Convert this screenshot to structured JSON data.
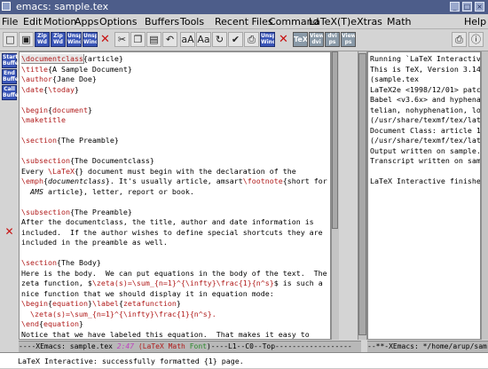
{
  "window": {
    "title": "emacs: sample.tex"
  },
  "menu": [
    "File",
    "Edit",
    "Motion",
    "Apps",
    "Options",
    "Buffers",
    "Tools",
    "Recent Files",
    "Command",
    "LaTeX",
    "(T)eXtras",
    "Math",
    "Help"
  ],
  "toolbar": {
    "zip1": "Zip\nWd",
    "zip2": "Zip\nWd",
    "unsplit1": "Unsplit\nWindow",
    "unsplit2": "Unsplit\nWindow",
    "tex_label": "TeX",
    "view_dvi": "View\ndvi",
    "dvi_ps": "dvi\nps",
    "view_ps": "View\nps"
  },
  "leftbar": {
    "start": "Start\nBuffer",
    "end": "End\nBuffer",
    "call": "Call\nBuffer"
  },
  "editor_lines": [
    [
      {
        "t": "\\documentclass",
        "k": 1
      },
      {
        "t": "{article}"
      }
    ],
    [
      {
        "t": "\\title",
        "k": 1
      },
      {
        "t": "{A Sample Document}"
      }
    ],
    [
      {
        "t": "\\author",
        "k": 1
      },
      {
        "t": "{Jane Doe}"
      }
    ],
    [
      {
        "t": "\\date",
        "k": 1
      },
      {
        "t": "{"
      },
      {
        "t": "\\today",
        "k": 1
      },
      {
        "t": "}"
      }
    ],
    [
      {
        "t": ""
      }
    ],
    [
      {
        "t": "\\begin",
        "k": 1
      },
      {
        "t": "{"
      },
      {
        "t": "document",
        "k": 1
      },
      {
        "t": "}"
      }
    ],
    [
      {
        "t": "\\maketitle",
        "k": 1
      }
    ],
    [
      {
        "t": ""
      }
    ],
    [
      {
        "t": "\\section",
        "k": 1
      },
      {
        "t": "{The Preamble}"
      }
    ],
    [
      {
        "t": ""
      }
    ],
    [
      {
        "t": "\\subsection",
        "k": 1
      },
      {
        "t": "{The Documentclass}"
      }
    ],
    [
      {
        "t": "Every "
      },
      {
        "t": "\\LaTeX",
        "k": 1
      },
      {
        "t": "{} document must begin with the declaration of the"
      }
    ],
    [
      {
        "t": "\\emph",
        "k": 1
      },
      {
        "t": "{"
      },
      {
        "t": "documentclass",
        "i": 1
      },
      {
        "t": "}. It's usually article, amsart"
      },
      {
        "t": "\\footnote",
        "k": 1
      },
      {
        "t": "{short for"
      }
    ],
    [
      {
        "t": "  "
      },
      {
        "t": "AMS",
        "i": 1
      },
      {
        "t": " article}, letter, report or book."
      }
    ],
    [
      {
        "t": ""
      }
    ],
    [
      {
        "t": "\\subsection",
        "k": 1
      },
      {
        "t": "{The Preamble}"
      }
    ],
    [
      {
        "t": "After the documentclass, the title, author and date information is"
      }
    ],
    [
      {
        "t": "included.  If the author wishes to define special shortcuts they are"
      }
    ],
    [
      {
        "t": "included in the preamble as well."
      }
    ],
    [
      {
        "t": ""
      }
    ],
    [
      {
        "t": "\\section",
        "k": 1
      },
      {
        "t": "{The Body}"
      }
    ],
    [
      {
        "t": "Here is the body.  We can put equations in the body of the text.  The"
      }
    ],
    [
      {
        "t": "zeta function, $"
      },
      {
        "t": "\\zeta(s)=\\sum_{n=1}^{\\infty}\\frac{1}{n^s}",
        "k": 1
      },
      {
        "t": "$ is such a"
      }
    ],
    [
      {
        "t": "nice function that we should display it in equation mode:"
      }
    ],
    [
      {
        "t": "\\begin",
        "k": 1
      },
      {
        "t": "{"
      },
      {
        "t": "equation",
        "k": 1
      },
      {
        "t": "}"
      },
      {
        "t": "\\label",
        "k": 1
      },
      {
        "t": "{"
      },
      {
        "t": "zetafunction",
        "k": 1
      },
      {
        "t": "}"
      }
    ],
    [
      {
        "t": "  \\zeta(s)=\\sum_{n=1}^{\\infty}\\frac{1}{n^s}.",
        "k": 1
      }
    ],
    [
      {
        "t": "\\end",
        "k": 1
      },
      {
        "t": "{"
      },
      {
        "t": "equation",
        "k": 1
      },
      {
        "t": "}"
      }
    ],
    [
      {
        "t": "Notice that we have labeled this equation.  That makes it easy to"
      }
    ]
  ],
  "output_lines": [
    "Running `LaTeX Interactive' o",
    "This is TeX, Version 3.14159",
    "(sample.tex",
    "LaTeX2e <1998/12/01> patch l",
    "Babel <v3.6x> and hyphenatio",
    "telian, nohyphenation, loaded.",
    "(/usr/share/texmf/tex/latex/",
    "Document Class: article 1999/",
    "(/usr/share/texmf/tex/latex/",
    "Output written on sample.dvi (",
    "Transcript written on sample.l",
    "",
    "LaTeX Interactive finished at"
  ],
  "modeline": {
    "left_prefix": "----XEmacs: ",
    "buffer": "sample.tex",
    "pos": "2:47",
    "mode": "(LaTeX Math",
    "font": "Font",
    "rest": ")----L1--C0--Top------------------",
    "right": "--**-XEmacs: */home/arup/sam"
  },
  "echo": "LaTeX Interactive: successfully formatted {1} page."
}
